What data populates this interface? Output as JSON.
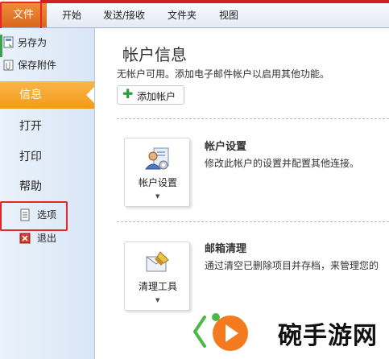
{
  "ribbon": {
    "file_tab": "文件",
    "tabs": [
      "开始",
      "发送/接收",
      "文件夹",
      "视图"
    ]
  },
  "nav": {
    "save_as": "另存为",
    "save_attachment": "保存附件",
    "info": "信息",
    "open": "打开",
    "print": "打印",
    "help": "帮助",
    "options": "选项",
    "exit": "退出"
  },
  "main": {
    "title": "帐户信息",
    "subtitle": "无帐户可用。添加电子邮件帐户以启用其他功能。",
    "add_account": "添加帐户",
    "account_settings": {
      "button": "帐户设置",
      "title": "帐户设置",
      "desc": "修改此帐户的设置并配置其他连接。"
    },
    "cleanup": {
      "button": "清理工具",
      "title": "邮箱清理",
      "desc": "通过清空已删除项目并存档，来管理您的"
    }
  },
  "watermark": {
    "text": "碗手游网"
  },
  "colors": {
    "accent_orange": "#f39a17",
    "file_tab": "#d8661c",
    "highlight_red": "#e4262a"
  }
}
